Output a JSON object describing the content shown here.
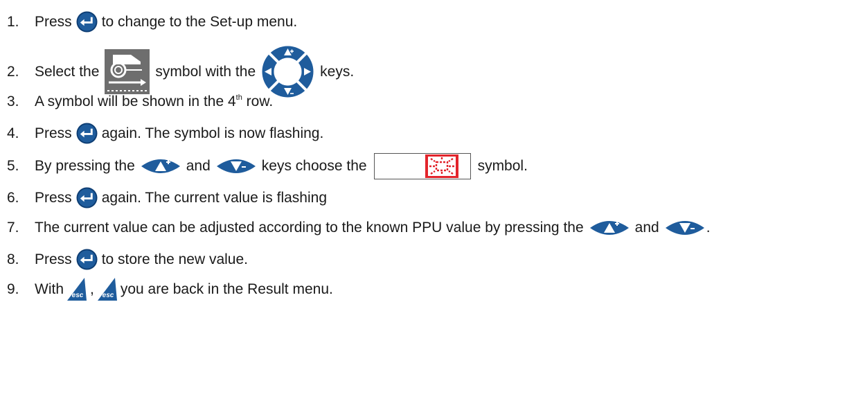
{
  "colors": {
    "key_blue": "#1f5c9c",
    "key_dark": "#0d3d73",
    "symbol_red": "#e2242b",
    "tractor_grey": "#6e6e6e",
    "text": "#1a1a1a"
  },
  "icons": {
    "enter": "enter-key-icon",
    "four_way": "four-way-arrow-keys-icon",
    "wheel": "tractor-wheel-symbol-icon",
    "up": "up-plus-key-icon",
    "down": "down-minus-key-icon",
    "sun": "red-sun-symbol-icon",
    "esc": "esc-key-icon"
  },
  "steps": [
    {
      "num": "1.",
      "a": "Press",
      "b": "to change to the Set-up menu."
    },
    {
      "num": "2.",
      "a": "Select the",
      "b": "symbol with the",
      "c": "keys."
    },
    {
      "num": "3.",
      "a": "A symbol will be shown in the 4",
      "sup": "th",
      "b": " row."
    },
    {
      "num": "4.",
      "a": "Press",
      "b": "again. The symbol is now flashing."
    },
    {
      "num": "5.",
      "a": "By pressing the",
      "b": "and",
      "c": "keys choose the",
      "d": "symbol."
    },
    {
      "num": "6.",
      "a": "Press",
      "b": "again. The current value is flashing"
    },
    {
      "num": "7.",
      "a": "The current value can be adjusted according to the known PPU value by pressing the",
      "b": "and",
      "c": "."
    },
    {
      "num": "8.",
      "a": "Press",
      "b": "to store the new value."
    },
    {
      "num": "9.",
      "a": "With",
      "b": ",",
      "c": "you are back in the Result menu."
    }
  ],
  "esc_key_label": "esc"
}
